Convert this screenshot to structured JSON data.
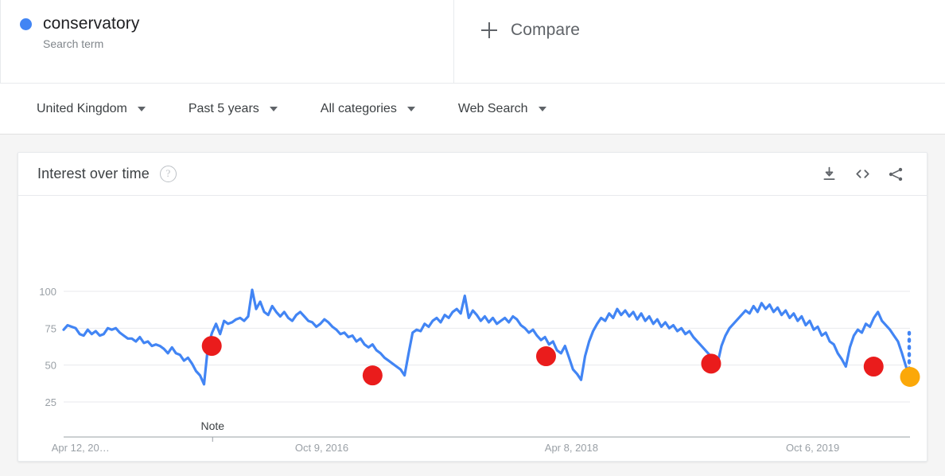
{
  "search_panel": {
    "term": "conservatory",
    "subtitle": "Search term",
    "dot_color": "#4285f4",
    "compare_label": "Compare",
    "plus_icon": "plus-icon"
  },
  "filters": [
    {
      "label": "United Kingdom",
      "icon": "chevron-down-icon"
    },
    {
      "label": "Past 5 years",
      "icon": "chevron-down-icon"
    },
    {
      "label": "All categories",
      "icon": "chevron-down-icon"
    },
    {
      "label": "Web Search",
      "icon": "chevron-down-icon"
    }
  ],
  "card": {
    "title": "Interest over time",
    "help_icon": "help-circle-icon",
    "help_glyph": "?",
    "actions": [
      {
        "name": "download-icon",
        "label": "Download"
      },
      {
        "name": "embed-icon",
        "label": "Embed"
      },
      {
        "name": "share-icon",
        "label": "Share"
      }
    ]
  },
  "chart_data": {
    "type": "line",
    "title": "Interest over time",
    "xlabel": "",
    "ylabel": "",
    "ylim": [
      0,
      110
    ],
    "yticks": [
      25,
      50,
      75,
      100
    ],
    "grid": true,
    "legend": false,
    "line_color": "#4285f4",
    "xtick_labels": [
      "Apr 12, 20…",
      "Oct 9, 2016",
      "Apr 8, 2018",
      "Oct 6, 2019"
    ],
    "xtick_positions_pct": [
      2,
      30.5,
      60,
      88.5
    ],
    "annotation": {
      "label": "Note",
      "x_pct": 17.6
    },
    "partial_data_dashed_tail": true,
    "markers": [
      {
        "x_pct": 17.5,
        "value": 63,
        "color": "#ea1c1c",
        "name": "event-marker-red"
      },
      {
        "x_pct": 36.5,
        "value": 43,
        "color": "#ea1c1c",
        "name": "event-marker-red"
      },
      {
        "x_pct": 57.0,
        "value": 56,
        "color": "#ea1c1c",
        "name": "event-marker-red"
      },
      {
        "x_pct": 76.5,
        "value": 51,
        "color": "#ea1c1c",
        "name": "event-marker-red"
      },
      {
        "x_pct": 95.7,
        "value": 49,
        "color": "#ea1c1c",
        "name": "event-marker-red"
      },
      {
        "x_pct": 100.0,
        "value": 42,
        "color": "#fba809",
        "name": "event-marker-orange"
      }
    ],
    "series": [
      {
        "name": "conservatory",
        "color": "#4285f4",
        "values": [
          74,
          77,
          76,
          75,
          71,
          70,
          74,
          71,
          73,
          70,
          71,
          75,
          74,
          75,
          72,
          70,
          68,
          68,
          66,
          69,
          65,
          66,
          63,
          64,
          63,
          61,
          58,
          62,
          58,
          57,
          53,
          55,
          51,
          46,
          43,
          37,
          63,
          72,
          78,
          71,
          80,
          78,
          79,
          81,
          82,
          80,
          83,
          101,
          88,
          93,
          86,
          84,
          90,
          86,
          83,
          86,
          82,
          80,
          84,
          86,
          83,
          80,
          79,
          76,
          78,
          81,
          79,
          76,
          74,
          71,
          72,
          69,
          70,
          66,
          68,
          64,
          62,
          64,
          60,
          58,
          55,
          53,
          51,
          49,
          47,
          43,
          58,
          72,
          74,
          73,
          78,
          76,
          80,
          82,
          79,
          84,
          82,
          86,
          88,
          85,
          97,
          82,
          87,
          84,
          80,
          83,
          79,
          82,
          78,
          80,
          82,
          79,
          83,
          81,
          77,
          75,
          72,
          74,
          70,
          67,
          69,
          64,
          66,
          60,
          58,
          63,
          55,
          47,
          44,
          40,
          56,
          66,
          73,
          78,
          82,
          80,
          85,
          82,
          88,
          84,
          87,
          83,
          86,
          81,
          85,
          80,
          83,
          78,
          81,
          76,
          79,
          75,
          77,
          73,
          75,
          71,
          73,
          69,
          66,
          63,
          60,
          57,
          54,
          51,
          63,
          70,
          75,
          78,
          81,
          84,
          87,
          85,
          90,
          86,
          92,
          88,
          91,
          86,
          89,
          84,
          87,
          82,
          85,
          80,
          83,
          77,
          80,
          74,
          76,
          70,
          72,
          66,
          64,
          58,
          54,
          49,
          62,
          70,
          74,
          72,
          78,
          76,
          82,
          86,
          80,
          77,
          74,
          70,
          66,
          58,
          49,
          42
        ]
      }
    ]
  }
}
